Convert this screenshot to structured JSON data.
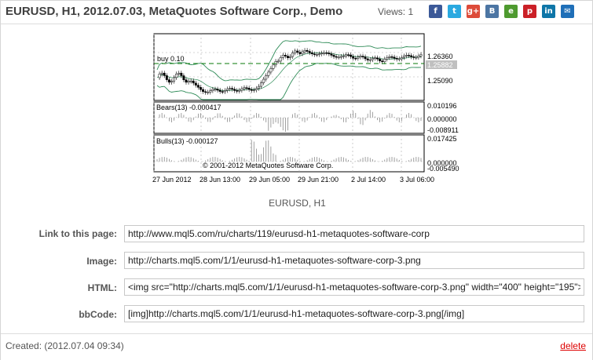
{
  "header": {
    "title": "EURUSD, H1, 2012.07.03, MetaQuotes Software Corp., Demo",
    "views_label": "Views:",
    "views_count": "1"
  },
  "share": [
    {
      "name": "facebook-icon",
      "glyph": "f",
      "color": "#3b5998"
    },
    {
      "name": "twitter-icon",
      "glyph": "t",
      "color": "#2aa9e0"
    },
    {
      "name": "google-plus-icon",
      "glyph": "g+",
      "color": "#dd4b39"
    },
    {
      "name": "vkontakte-icon",
      "glyph": "B",
      "color": "#4c75a3"
    },
    {
      "name": "evernote-icon",
      "glyph": "e",
      "color": "#4e9a2f"
    },
    {
      "name": "pinterest-icon",
      "glyph": "p",
      "color": "#cb2027"
    },
    {
      "name": "linkedin-icon",
      "glyph": "in",
      "color": "#0e76a8"
    },
    {
      "name": "email-icon",
      "glyph": "✉",
      "color": "#1f6fb8"
    }
  ],
  "chart": {
    "symbol_caption": "EURUSD, H1",
    "trade_label": "buy 0.10",
    "price_labels": [
      "1.26360",
      "1.25882",
      "1.25090"
    ],
    "bears_label": "Bears(13) -0.000417",
    "bears_ticks": [
      "0.010196",
      "0.000000",
      "-0.008911"
    ],
    "bulls_label": "Bulls(13) -0.000127",
    "bulls_ticks": [
      "0.017425",
      "0.000000",
      "-0.005490"
    ],
    "copyright": "© 2001-2012 MetaQuotes Software Corp.",
    "time_labels": [
      "27 Jun 2012",
      "28 Jun 13:00",
      "29 Jun 05:00",
      "29 Jun 21:00",
      "2 Jul 14:00",
      "3 Jul 06:00"
    ]
  },
  "form": {
    "link_label": "Link to this page:",
    "link_value": "http://www.mql5.com/ru/charts/119/eurusd-h1-metaquotes-software-corp",
    "image_label": "Image:",
    "image_value": "http://charts.mql5.com/1/1/eurusd-h1-metaquotes-software-corp-3.png",
    "html_label": "HTML:",
    "html_value": "<img src=\"http://charts.mql5.com/1/1/eurusd-h1-metaquotes-software-corp-3.png\" width=\"400\" height=\"195\">",
    "bbcode_label": "bbCode:",
    "bbcode_value": "[img]http://charts.mql5.com/1/1/eurusd-h1-metaquotes-software-corp-3.png[/img]"
  },
  "footer": {
    "created": "Created: (2012.07.04 09:34)",
    "delete_label": "delete"
  }
}
